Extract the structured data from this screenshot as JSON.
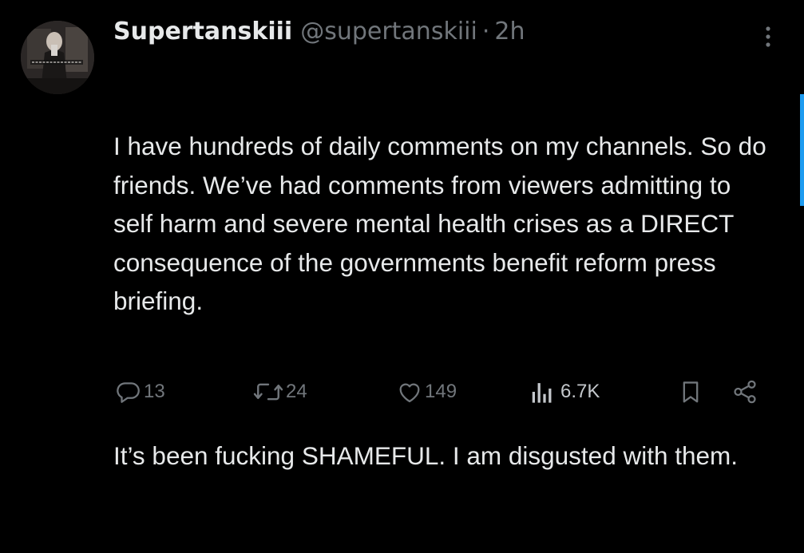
{
  "tweet": {
    "author": {
      "display_name": "Supertanskiii",
      "handle": "@supertanskiii",
      "separator": "·",
      "timestamp": "2h",
      "avatar": "avatar-photo"
    },
    "paragraphs": [
      "I have hundreds of daily comments on my channels. So do friends. We’ve had comments from viewers admitting to self harm and severe mental health crises as a DIRECT consequence of the governments benefit reform press briefing.",
      "It’s been fucking SHAMEFUL. I am disgusted with them."
    ],
    "actions": {
      "replies": "13",
      "reposts": "24",
      "likes": "149",
      "views": "6.7K"
    },
    "icons": {
      "more": "more-vertical-icon",
      "reply": "reply-icon",
      "repost": "repost-icon",
      "like": "heart-icon",
      "views": "views-icon",
      "bookmark": "bookmark-icon",
      "share": "share-icon"
    }
  },
  "colors": {
    "background": "#000000",
    "primary_text": "#e7e9ea",
    "secondary_text": "#71767b",
    "accent": "#1d9bf0"
  }
}
